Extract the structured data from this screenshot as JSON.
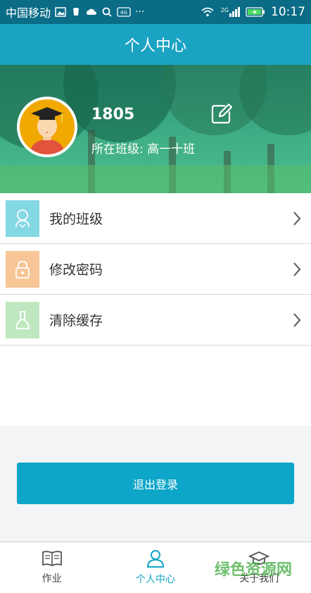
{
  "status_bar": {
    "carrier": "中国移动",
    "network": "2G",
    "time": "10:17"
  },
  "header": {
    "title": "个人中心"
  },
  "profile": {
    "username": "1805",
    "class_label": "所在班级: 高一十班"
  },
  "menu": {
    "items": [
      {
        "label": "我的班级",
        "icon": "class-icon",
        "color": "#84d8e3"
      },
      {
        "label": "修改密码",
        "icon": "lock-icon",
        "color": "#f8c596"
      },
      {
        "label": "清除缓存",
        "icon": "brush-icon",
        "color": "#bfe8c0"
      }
    ]
  },
  "logout": {
    "label": "退出登录"
  },
  "tabbar": {
    "tabs": [
      {
        "label": "作业",
        "icon": "book-icon"
      },
      {
        "label": "个人中心",
        "icon": "person-icon"
      },
      {
        "label": "关于我们",
        "icon": "graduation-cap-icon"
      }
    ],
    "active_color": "#14a5c7"
  },
  "watermark": "绿色资源网"
}
